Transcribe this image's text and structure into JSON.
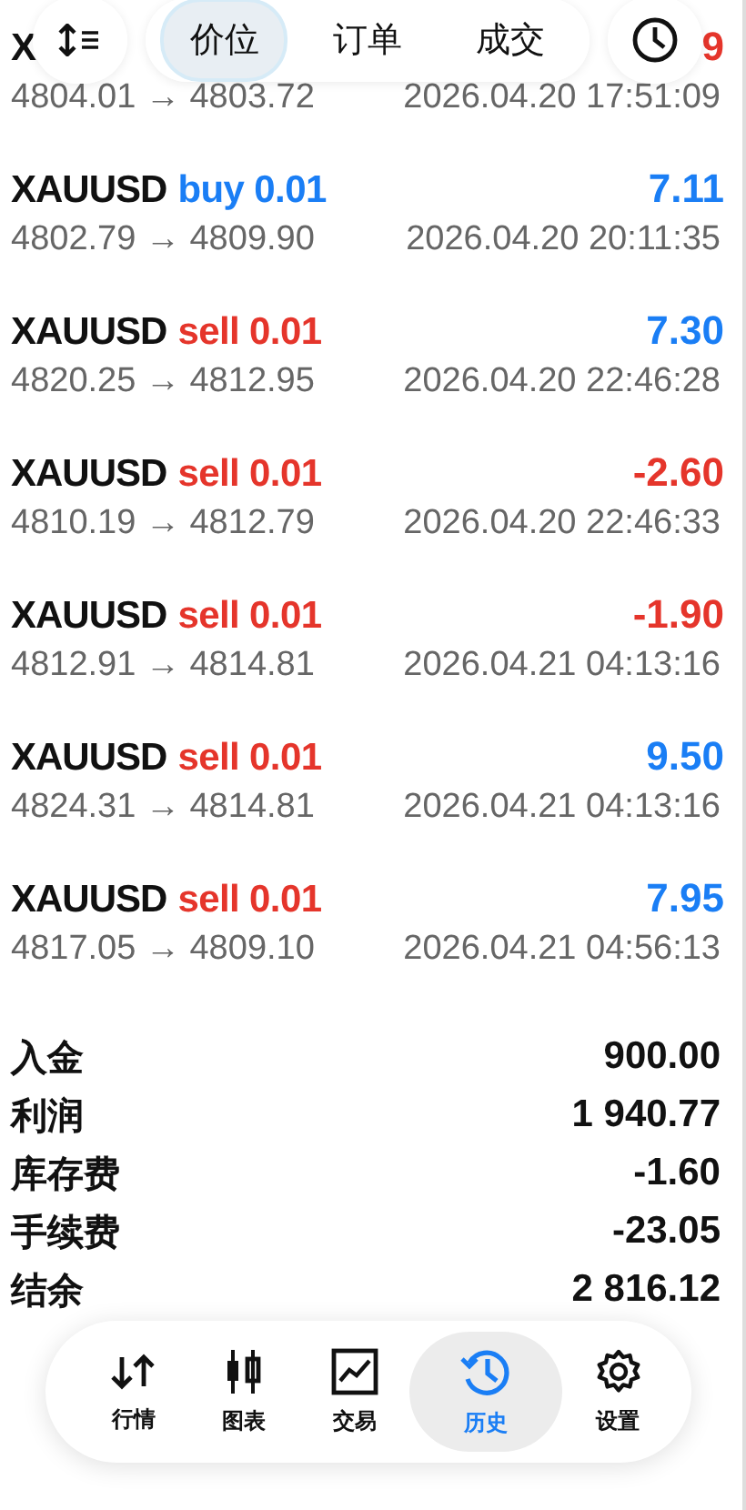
{
  "top_bar": {
    "tabs": [
      {
        "label": "价位",
        "selected": true
      },
      {
        "label": "订单",
        "selected": false
      },
      {
        "label": "成交",
        "selected": false
      }
    ]
  },
  "trades": [
    {
      "symbol": "X",
      "profit": "9",
      "color": "#e5352b",
      "prices": "4804.01 → 4803.72",
      "time": "2026.04.20 17:51:09"
    },
    {
      "symbol": "XAUUSD",
      "side": "buy",
      "volume": "0.01",
      "profit": "7.11",
      "color": "#1a7ef5",
      "prices": "4802.79 → 4809.90",
      "time": "2026.04.20 20:11:35"
    },
    {
      "symbol": "XAUUSD",
      "side": "sell",
      "volume": "0.01",
      "profit": "7.30",
      "color": "#1a7ef5",
      "prices": "4820.25 → 4812.95",
      "time": "2026.04.20 22:46:28"
    },
    {
      "symbol": "XAUUSD",
      "side": "sell",
      "volume": "0.01",
      "profit": "-2.60",
      "color": "#e5352b",
      "prices": "4810.19 → 4812.79",
      "time": "2026.04.20 22:46:33"
    },
    {
      "symbol": "XAUUSD",
      "side": "sell",
      "volume": "0.01",
      "profit": "-1.90",
      "color": "#e5352b",
      "prices": "4812.91 → 4814.81",
      "time": "2026.04.21 04:13:16"
    },
    {
      "symbol": "XAUUSD",
      "side": "sell",
      "volume": "0.01",
      "profit": "9.50",
      "color": "#1a7ef5",
      "prices": "4824.31 → 4814.81",
      "time": "2026.04.21 04:13:16"
    },
    {
      "symbol": "XAUUSD",
      "side": "sell",
      "volume": "0.01",
      "profit": "7.95",
      "color": "#1a7ef5",
      "prices": "4817.05 → 4809.10",
      "time": "2026.04.21 04:56:13"
    }
  ],
  "summary": [
    {
      "label": "入金",
      "value": "900.00"
    },
    {
      "label": "利润",
      "value": "1 940.77"
    },
    {
      "label": "库存费",
      "value": "-1.60"
    },
    {
      "label": "手续费",
      "value": "-23.05"
    },
    {
      "label": "结余",
      "value": "2 816.12"
    }
  ],
  "nav": [
    {
      "kind": "quotes",
      "label": "行情",
      "selected": false
    },
    {
      "kind": "chart",
      "label": "图表",
      "selected": false
    },
    {
      "kind": "trade",
      "label": "交易",
      "selected": false
    },
    {
      "kind": "history",
      "label": "历史",
      "selected": true
    },
    {
      "kind": "settings",
      "label": "设置",
      "selected": false
    }
  ]
}
